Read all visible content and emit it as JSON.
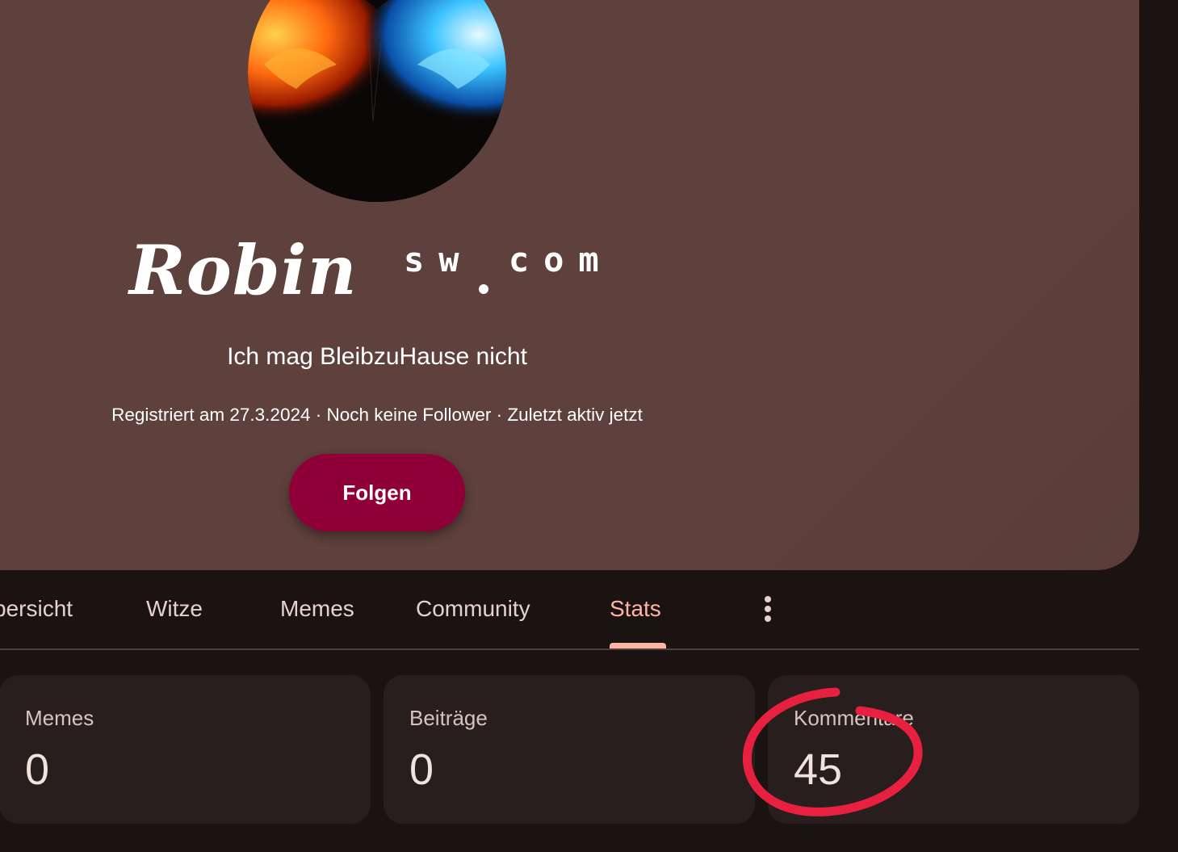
{
  "profile": {
    "name_script": "Robin",
    "name_suffix": "sw com",
    "bio": "Ich mag BleibzuHause nicht",
    "meta": "Registriert am 27.3.2024 · Noch keine Follower · Zuletzt aktiv jetzt",
    "follow_label": "Folgen"
  },
  "tabs": [
    {
      "label": "bersicht",
      "active": false
    },
    {
      "label": "Witze",
      "active": false
    },
    {
      "label": "Memes",
      "active": false
    },
    {
      "label": "Community",
      "active": false
    },
    {
      "label": "Stats",
      "active": true
    }
  ],
  "stats": [
    {
      "label": "Memes",
      "value": "0"
    },
    {
      "label": "Beiträge",
      "value": "0"
    },
    {
      "label": "Kommentare",
      "value": "45"
    }
  ],
  "colors": {
    "accent": "#ffb4a4",
    "button": "#8f0038",
    "annotation": "#e8203f"
  },
  "icons": {
    "more": "more-vertical-icon"
  }
}
